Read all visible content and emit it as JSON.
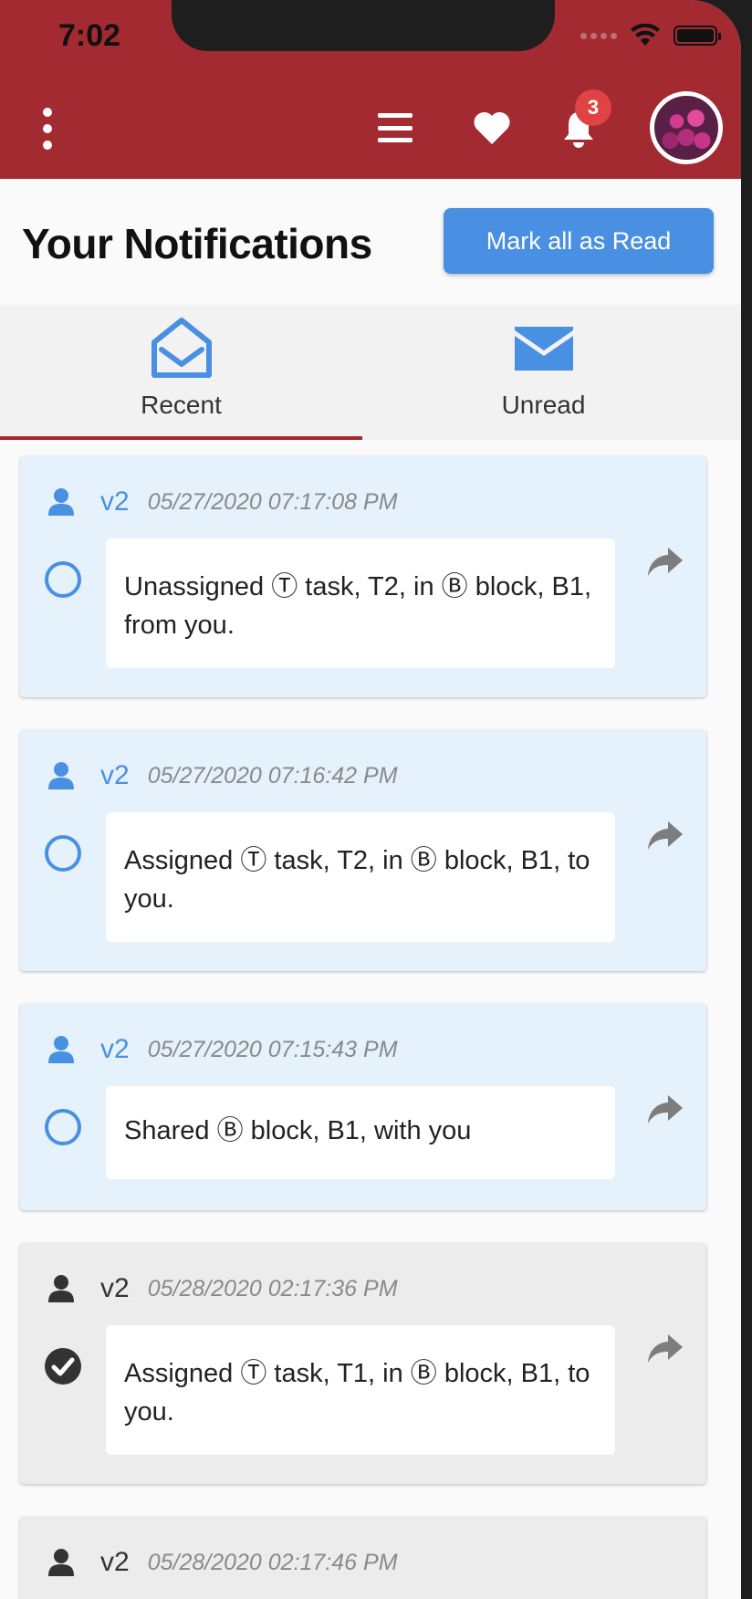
{
  "status_bar": {
    "time": "7:02"
  },
  "header": {
    "notification_count": "3",
    "icons": [
      "more-vert-icon",
      "menu-icon",
      "heart-icon",
      "bell-icon"
    ],
    "accent": "#a32a31"
  },
  "page": {
    "title": "Your Notifications",
    "mark_all_label": "Mark all as Read"
  },
  "tabs": [
    {
      "label": "Recent",
      "icon": "envelope-open-icon",
      "active": true
    },
    {
      "label": "Unread",
      "icon": "envelope-icon",
      "active": false
    }
  ],
  "notifications": [
    {
      "user": "v2",
      "timestamp": "05/27/2020 07:17:08 PM",
      "message": "Unassigned Ⓣ task, T2, in Ⓑ block, B1, from you.",
      "read": false
    },
    {
      "user": "v2",
      "timestamp": "05/27/2020 07:16:42 PM",
      "message": "Assigned Ⓣ task, T2, in Ⓑ block, B1, to you.",
      "read": false
    },
    {
      "user": "v2",
      "timestamp": "05/27/2020 07:15:43 PM",
      "message": "Shared Ⓑ block, B1, with you",
      "read": false
    },
    {
      "user": "v2",
      "timestamp": "05/28/2020 02:17:36 PM",
      "message": "Assigned Ⓣ task, T1, in Ⓑ block, B1, to you.",
      "read": true
    },
    {
      "user": "v2",
      "timestamp": "05/28/2020 02:17:46 PM",
      "message": "",
      "read": true
    }
  ],
  "colors": {
    "unread_bg": "#e5f1fb",
    "read_bg": "#ececec",
    "blue": "#4a90e2"
  }
}
